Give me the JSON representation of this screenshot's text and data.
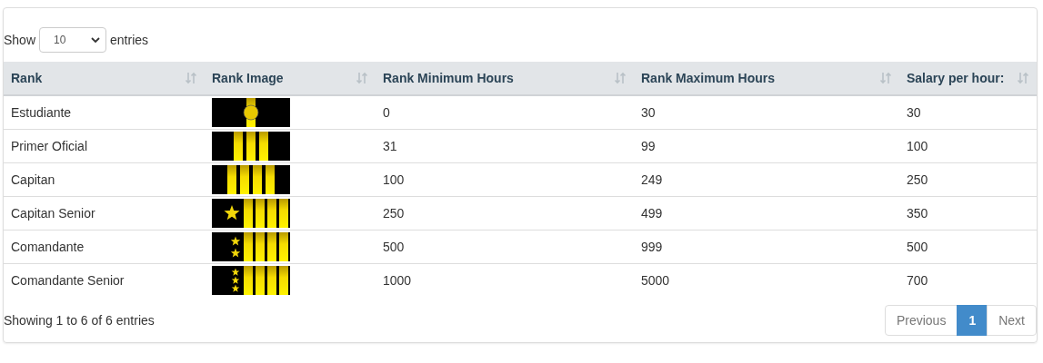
{
  "length_control": {
    "before": "Show",
    "value": "10",
    "after": "entries"
  },
  "columns": [
    "Rank",
    "Rank Image",
    "Rank Minimum Hours",
    "Rank Maximum Hours",
    "Salary per hour:"
  ],
  "rows": [
    {
      "rank": "Estudiante",
      "insignia": {
        "kind": "disc"
      },
      "min": "0",
      "max": "30",
      "salary": "30"
    },
    {
      "rank": "Primer Oficial",
      "insignia": {
        "kind": "three"
      },
      "min": "31",
      "max": "99",
      "salary": "100"
    },
    {
      "rank": "Capitan",
      "insignia": {
        "kind": "four"
      },
      "min": "100",
      "max": "249",
      "salary": "250"
    },
    {
      "rank": "Capitan Senior",
      "insignia": {
        "kind": "onestar"
      },
      "min": "250",
      "max": "499",
      "salary": "350"
    },
    {
      "rank": "Comandante",
      "insignia": {
        "kind": "twostar"
      },
      "min": "500",
      "max": "999",
      "salary": "500"
    },
    {
      "rank": "Comandante Senior",
      "insignia": {
        "kind": "threestar"
      },
      "min": "1000",
      "max": "5000",
      "salary": "700"
    }
  ],
  "info": "Showing 1 to 6 of 6 entries",
  "pagination": [
    {
      "label": "Previous",
      "selected": false
    },
    {
      "label": "1",
      "selected": true
    },
    {
      "label": "Next",
      "selected": false
    }
  ]
}
